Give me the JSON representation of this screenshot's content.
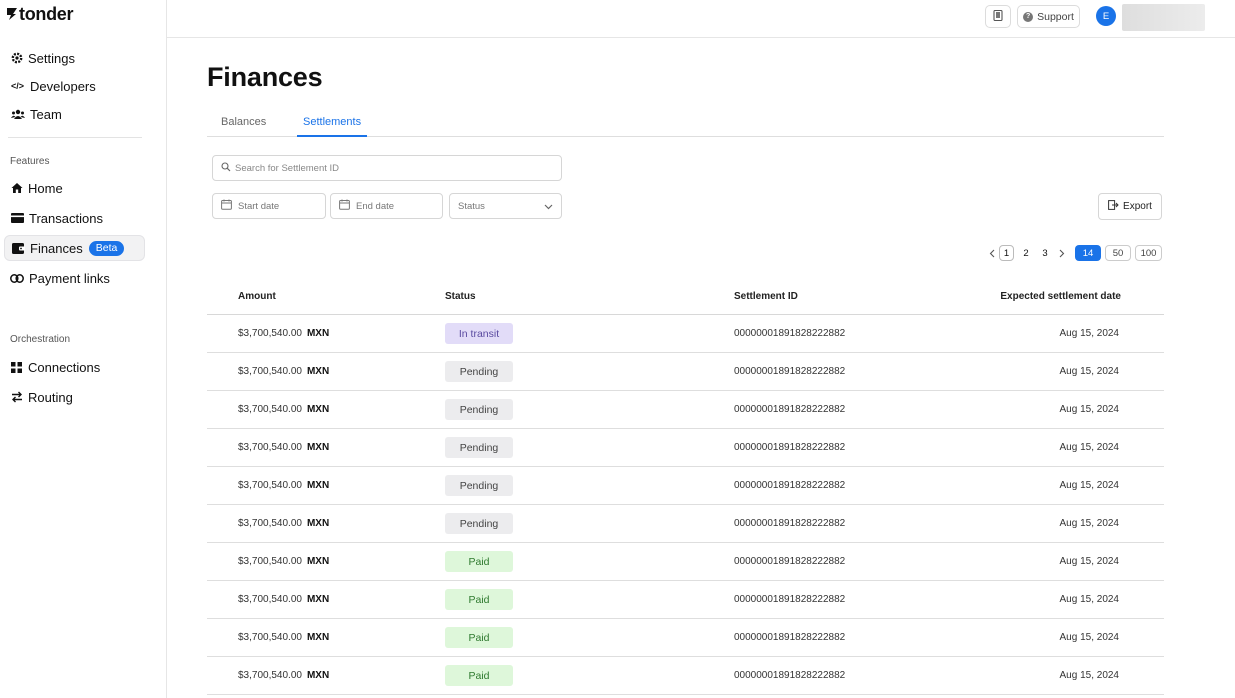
{
  "brand": {
    "name": "tonder"
  },
  "sidebar": {
    "top_items": [
      {
        "label": "Settings",
        "icon": "gear-icon"
      },
      {
        "label": "Developers",
        "icon": "code-icon"
      },
      {
        "label": "Team",
        "icon": "team-icon"
      }
    ],
    "features_label": "Features",
    "feature_items": [
      {
        "label": "Home",
        "icon": "home-icon"
      },
      {
        "label": "Transactions",
        "icon": "card-icon"
      },
      {
        "label": "Finances",
        "icon": "wallet-icon",
        "badge": "Beta",
        "active": true
      },
      {
        "label": "Payment links",
        "icon": "link-icon"
      }
    ],
    "orchestration_label": "Orchestration",
    "orchestration_items": [
      {
        "label": "Connections",
        "icon": "grid-icon"
      },
      {
        "label": "Routing",
        "icon": "routing-icon"
      }
    ]
  },
  "header": {
    "support_label": "Support",
    "avatar_initial": "E"
  },
  "page": {
    "title": "Finances",
    "tabs": [
      {
        "label": "Balances",
        "active": false
      },
      {
        "label": "Settlements",
        "active": true
      }
    ]
  },
  "filters": {
    "search_placeholder": "Search for Settlement ID",
    "start_date_placeholder": "Start date",
    "end_date_placeholder": "End date",
    "status_placeholder": "Status",
    "export_label": "Export"
  },
  "pagination": {
    "pages": [
      "1",
      "2",
      "3"
    ],
    "current_page": "1",
    "page_sizes": [
      "14",
      "50",
      "100"
    ],
    "selected_size": "14"
  },
  "table": {
    "columns": {
      "amount": "Amount",
      "status": "Status",
      "settlement_id": "Settlement ID",
      "expected_date": "Expected settlement date"
    },
    "rows": [
      {
        "amount": "$3,700,540.00",
        "currency": "MXN",
        "status": "In transit",
        "status_type": "transit",
        "settlement_id": "00000001891828222882",
        "date": "Aug 15, 2024"
      },
      {
        "amount": "$3,700,540.00",
        "currency": "MXN",
        "status": "Pending",
        "status_type": "pending",
        "settlement_id": "00000001891828222882",
        "date": "Aug 15, 2024"
      },
      {
        "amount": "$3,700,540.00",
        "currency": "MXN",
        "status": "Pending",
        "status_type": "pending",
        "settlement_id": "00000001891828222882",
        "date": "Aug 15, 2024"
      },
      {
        "amount": "$3,700,540.00",
        "currency": "MXN",
        "status": "Pending",
        "status_type": "pending",
        "settlement_id": "00000001891828222882",
        "date": "Aug 15, 2024"
      },
      {
        "amount": "$3,700,540.00",
        "currency": "MXN",
        "status": "Pending",
        "status_type": "pending",
        "settlement_id": "00000001891828222882",
        "date": "Aug 15, 2024"
      },
      {
        "amount": "$3,700,540.00",
        "currency": "MXN",
        "status": "Pending",
        "status_type": "pending",
        "settlement_id": "00000001891828222882",
        "date": "Aug 15, 2024"
      },
      {
        "amount": "$3,700,540.00",
        "currency": "MXN",
        "status": "Paid",
        "status_type": "paid",
        "settlement_id": "00000001891828222882",
        "date": "Aug 15, 2024"
      },
      {
        "amount": "$3,700,540.00",
        "currency": "MXN",
        "status": "Paid",
        "status_type": "paid",
        "settlement_id": "00000001891828222882",
        "date": "Aug 15, 2024"
      },
      {
        "amount": "$3,700,540.00",
        "currency": "MXN",
        "status": "Paid",
        "status_type": "paid",
        "settlement_id": "00000001891828222882",
        "date": "Aug 15, 2024"
      },
      {
        "amount": "$3,700,540.00",
        "currency": "MXN",
        "status": "Paid",
        "status_type": "paid",
        "settlement_id": "00000001891828222882",
        "date": "Aug 15, 2024"
      }
    ]
  },
  "colors": {
    "accent": "#1a73e8",
    "transit_bg": "#e2dcf8",
    "pending_bg": "#ececee",
    "paid_bg": "#def7da"
  }
}
